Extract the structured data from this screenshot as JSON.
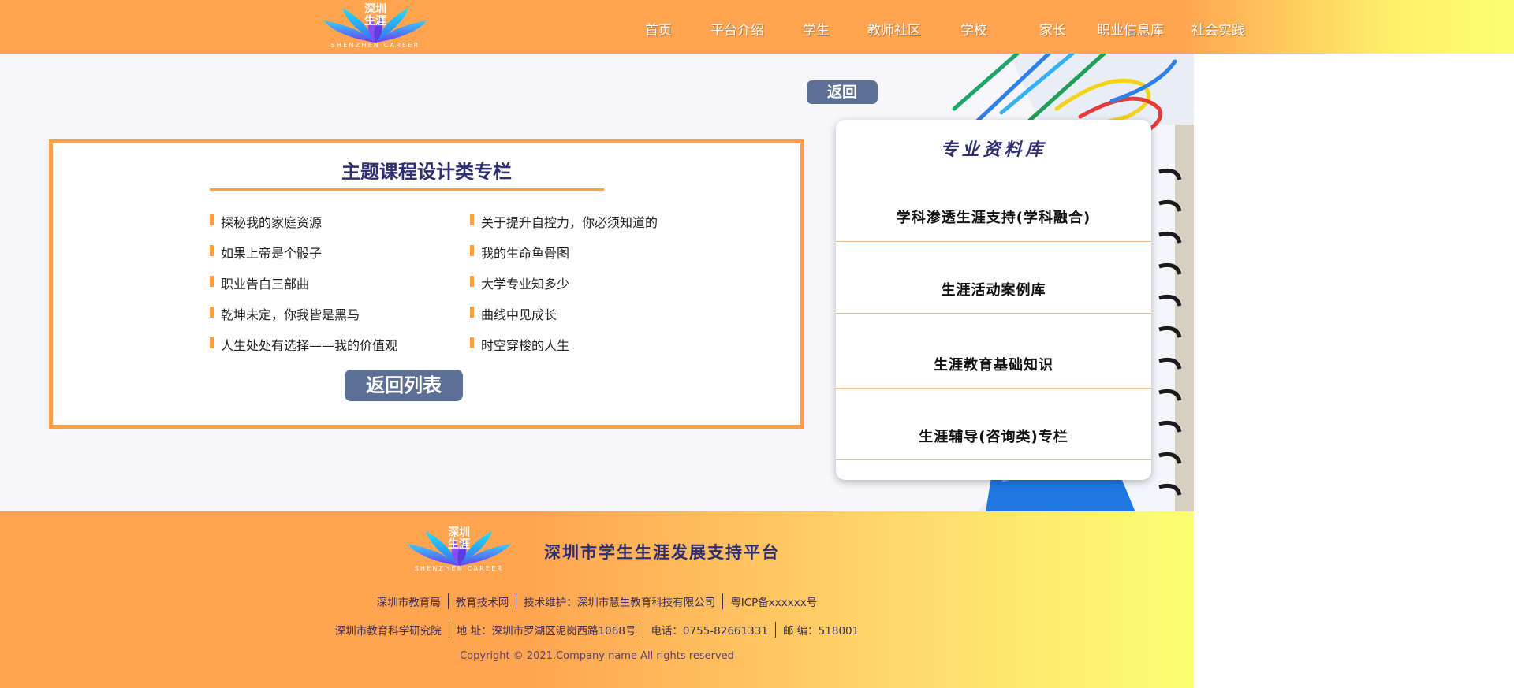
{
  "header": {
    "logo": {
      "text_cn_line1": "深圳",
      "text_cn_line2": "生涯",
      "text_en": "SHENZHEN CAREER"
    },
    "nav": [
      {
        "label": "首页"
      },
      {
        "label": "平台介绍"
      },
      {
        "label": "学生"
      },
      {
        "label": "教师社区"
      },
      {
        "label": "学校"
      },
      {
        "label": "家长"
      },
      {
        "label": "职业信息库"
      },
      {
        "label": "社会实践"
      }
    ]
  },
  "main": {
    "back_label": "返回",
    "column": {
      "title": "主题课程设计类专栏",
      "articles_left": [
        "探秘我的家庭资源",
        "如果上帝是个骰子",
        "职业告白三部曲",
        "乾坤未定，你我皆是黑马",
        "人生处处有选择——我的价值观"
      ],
      "articles_right": [
        "关于提升自控力，你必须知道的",
        "我的生命鱼骨图",
        "大学专业知多少",
        "曲线中见成长",
        "时空穿梭的人生"
      ],
      "back_list_label": "返回列表"
    },
    "library": {
      "title": "专业资料库",
      "items": [
        "学科渗透生涯支持(学科融合)",
        "生涯活动案例库",
        "生涯教育基础知识",
        "生涯辅导(咨询类)专栏"
      ]
    }
  },
  "footer": {
    "logo": {
      "text_cn_line1": "深圳",
      "text_cn_line2": "生涯",
      "text_en": "SHENZHEN CAREER"
    },
    "title": "深圳市学生生涯发展支持平台",
    "row1": [
      "深圳市教育局",
      "教育技术网",
      "技术维护：深圳市慧生教育科技有限公司",
      "粤ICP备xxxxxx号"
    ],
    "row2": [
      "深圳市教育科学研究院",
      "地  址：深圳市罗湖区泥岗西路1068号",
      "电话：0755-82661331",
      "邮  编：518001"
    ],
    "copyright": "Copyright © 2021.Company name All rights reserved"
  },
  "colors": {
    "orange": "#ffa451",
    "yellow": "#fbff71",
    "navy": "#2e2e72",
    "button_blue": "#5c6f94",
    "accent_border": "#ff9f43"
  }
}
